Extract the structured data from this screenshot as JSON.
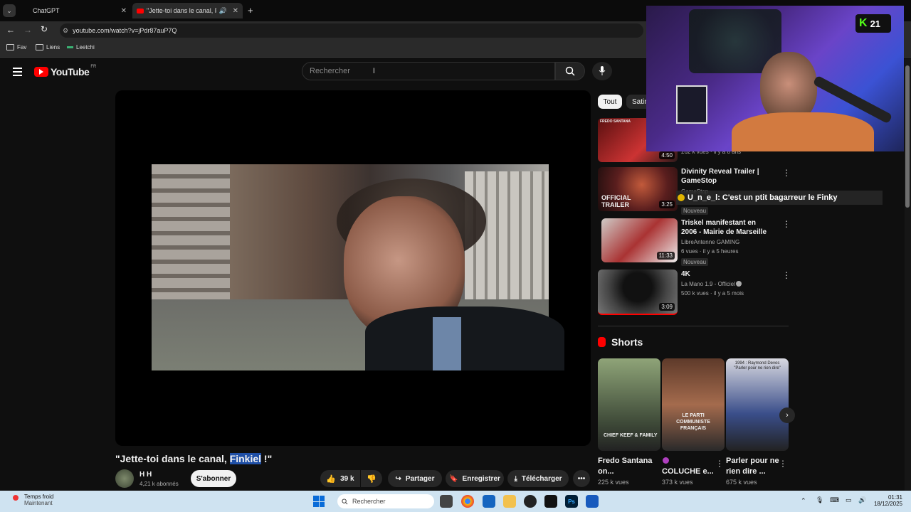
{
  "browser": {
    "tabs": [
      {
        "label": "ChatGPT",
        "active": false
      },
      {
        "label": "\"Jette-toi dans le canal, Fink",
        "active": true
      }
    ],
    "url": "youtube.com/watch?v=jPdr87auP7Q",
    "bookmarks": [
      "Fav",
      "Liens",
      "Leetchi"
    ]
  },
  "youtube": {
    "logo_text": "YouTube",
    "region": "FR",
    "search_placeholder": "Rechercher"
  },
  "video": {
    "title_prefix": "\"Jette-toi dans le canal, ",
    "title_highlight": "Finkiel",
    "title_suffix": " !\"",
    "channel": "H H",
    "subscribers": "4,21 k abonnés",
    "subscribe_label": "S'abonner",
    "likes": "39 k",
    "share_label": "Partager",
    "save_label": "Enregistrer",
    "download_label": "Télécharger"
  },
  "chips": [
    "Tout",
    "Satin"
  ],
  "recommendations": [
    {
      "title": "",
      "channel": "",
      "meta": "262 k vues · il y a 8 ans",
      "duration": "4:50",
      "thumb_text": "FREDO SANTANA",
      "badge": ""
    },
    {
      "title": "Divinity Reveal Trailer | GameStop",
      "channel": "GameStop",
      "meta": "",
      "duration": "3:25",
      "thumb_text": "OFFICIAL TRAILER",
      "badge": "Nouveau"
    },
    {
      "title": "Triskel manifestant en 2006 - Mairie de Marseille",
      "channel": "LibreAntenne GAMING",
      "meta": "6 vues · il y a 5 heures",
      "duration": "11:33",
      "thumb_text": "",
      "badge": "Nouveau"
    },
    {
      "title": "4K",
      "channel": "La Mano 1.9 - Officiel",
      "meta": "500 k vues · il y a 5 mois",
      "duration": "3:09",
      "thumb_text": "",
      "badge": ""
    }
  ],
  "chat_overlay": "U_n_e_l: C'est un ptit bagarreur le Finky",
  "shorts": {
    "heading": "Shorts",
    "items": [
      {
        "title": "Fredo Santana on...",
        "views": "225 k vues",
        "thumb_text": "CHIEF KEEF & FAMILY"
      },
      {
        "title": "COLUCHE e...",
        "views": "373 k vues",
        "thumb_text": "LE PARTI COMMUNISTE FRANÇAIS"
      },
      {
        "title": "Parler pour ne rien dire ...",
        "views": "675 k vues",
        "thumb_text": "1994 : Raymond Devos \"Parler pour ne rien dire\""
      }
    ]
  },
  "stream": {
    "viewers": "21"
  },
  "taskbar": {
    "weather_title": "Temps froid",
    "weather_sub": "Maintenant",
    "search_label": "Rechercher",
    "time": "01:31",
    "date": "18/12/2025"
  }
}
